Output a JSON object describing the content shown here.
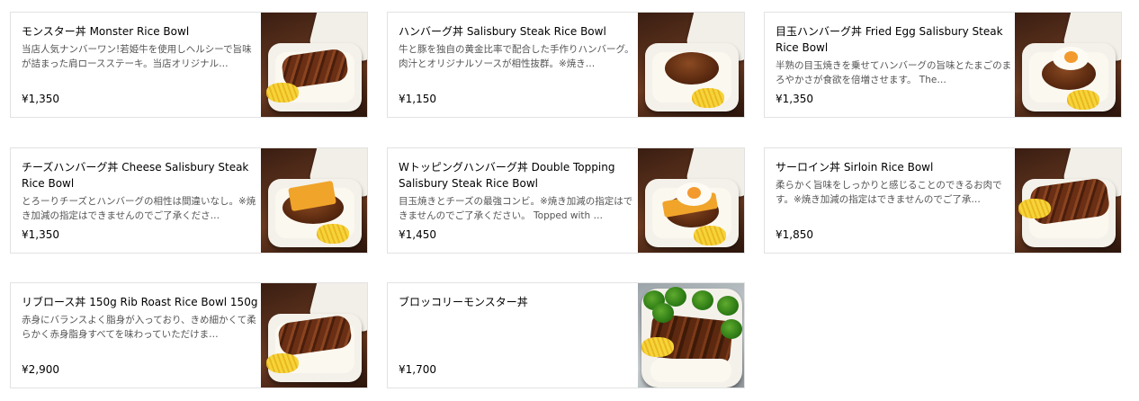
{
  "menu": {
    "items": [
      {
        "title": "モンスター丼 Monster Rice Bowl",
        "description": "当店人気ナンバーワン!若姫牛を使用しヘルシーで旨味が詰まった肩ロースステーキ。当店オリジナル…",
        "price": "¥1,350",
        "photo": "steak-rice-bowl-photo"
      },
      {
        "title": "ハンバーグ丼 Salisbury Steak Rice Bowl",
        "description": "牛と豚を独自の黄金比率で配合した手作りハンバーグ。肉汁とオリジナルソースが相性抜群。※焼き…",
        "price": "¥1,150",
        "photo": "hamburg-rice-bowl-photo"
      },
      {
        "title": "目玉ハンバーグ丼 Fried Egg Salisbury Steak Rice Bowl",
        "description": "半熟の目玉焼きを乗せてハンバーグの旨味とたまごのまろやかさが食欲を倍増させます。 The…",
        "price": "¥1,350",
        "photo": "fried-egg-hamburg-photo"
      },
      {
        "title": "チーズハンバーグ丼 Cheese Salisbury Steak Rice Bowl",
        "description": "とろーりチーズとハンバーグの相性は間違いなし。※焼き加減の指定はできませんのでご了承くださ…",
        "price": "¥1,350",
        "photo": "cheese-hamburg-photo"
      },
      {
        "title": "Wトッピングハンバーグ丼 Double Topping Salisbury Steak Rice Bowl",
        "description": "目玉焼きとチーズの最強コンビ。※焼き加減の指定はできませんのでご了承ください。 Topped with …",
        "price": "¥1,450",
        "photo": "double-topping-hamburg-photo"
      },
      {
        "title": "サーロイン丼 Sirloin Rice Bowl",
        "description": "柔らかく旨味をしっかりと感じることのできるお肉です。※焼き加減の指定はできませんのでご了承…",
        "price": "¥1,850",
        "photo": "sirloin-rice-bowl-photo"
      },
      {
        "title": "リブロース丼 150g Rib Roast Rice Bowl 150g",
        "description": "赤身にバランスよく脂身が入っており、きめ細かくて柔らかく赤身脂身すべてを味わっていただけま…",
        "price": "¥2,900",
        "photo": "rib-roast-rice-bowl-photo"
      },
      {
        "title": "ブロッコリーモンスター丼",
        "description": "",
        "price": "¥1,700",
        "photo": "broccoli-monster-bowl-photo"
      }
    ]
  }
}
